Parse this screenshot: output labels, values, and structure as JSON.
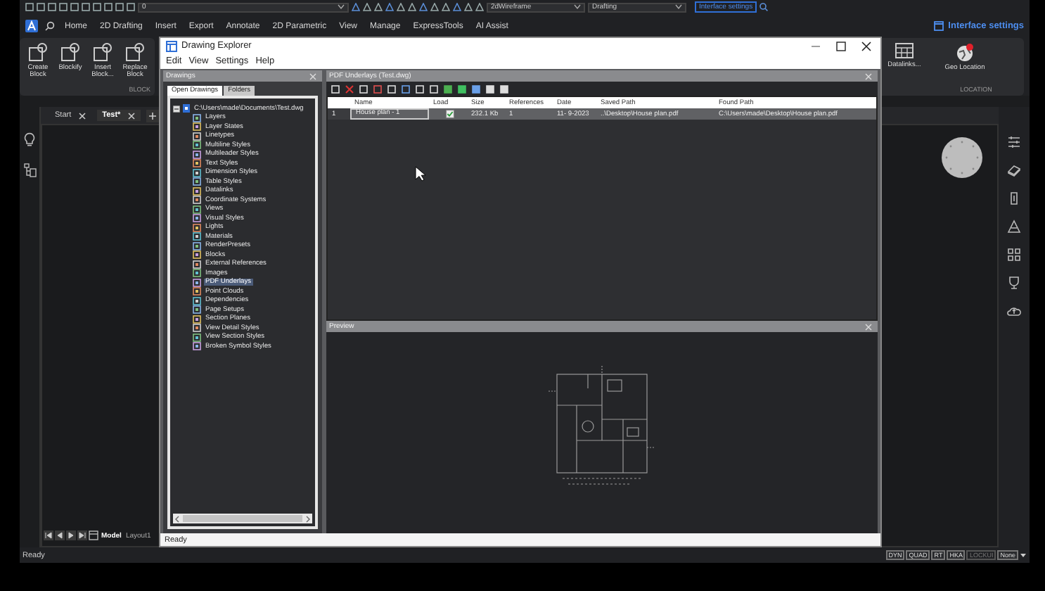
{
  "quick_access": {
    "layer": "0",
    "visual_style": "2dWireframe",
    "workspace": "Drafting",
    "link": "Interface settings"
  },
  "ribbon_tabs": [
    {
      "label": "Home",
      "selected": false
    },
    {
      "label": "2D Drafting",
      "selected": false
    },
    {
      "label": "Insert",
      "selected": false
    },
    {
      "label": "Export",
      "selected": false
    },
    {
      "label": "Annotate",
      "selected": false
    },
    {
      "label": "2D Parametric",
      "selected": false
    },
    {
      "label": "View",
      "selected": false
    },
    {
      "label": "Manage",
      "selected": false
    },
    {
      "label": "ExpressTools",
      "selected": false
    },
    {
      "label": "AI Assist",
      "selected": false
    }
  ],
  "interface_settings": "Interface settings",
  "ribbon": {
    "block_tools": [
      "Create Block",
      "Blockify",
      "Insert Block...",
      "Replace Block"
    ],
    "block_panel": "BLOCK",
    "datalinks": "Datalinks...",
    "geo_location": "Geo Location",
    "location_panel": "LOCATION"
  },
  "doc_tabs": [
    {
      "label": "Start",
      "selected": false
    },
    {
      "label": "Test*",
      "selected": true
    }
  ],
  "layout_tabs": [
    {
      "label": "Model",
      "selected": true
    },
    {
      "label": "Layout1",
      "selected": false
    }
  ],
  "status": "Ready",
  "status_toggles": [
    {
      "label": "DYN",
      "on": true
    },
    {
      "label": "QUAD",
      "on": true
    },
    {
      "label": "RT",
      "on": true
    },
    {
      "label": "HKA",
      "on": true
    },
    {
      "label": "LOCKUI",
      "on": false
    }
  ],
  "annotation_scale": "None",
  "explorer": {
    "title": "Drawing Explorer",
    "menu": [
      "Edit",
      "View",
      "Settings",
      "Help"
    ],
    "drawings_header": "Drawings",
    "side_tabs": [
      {
        "label": "Open Drawings",
        "selected": true
      },
      {
        "label": "Folders",
        "selected": false
      }
    ],
    "tree": {
      "label": "C:\\Users\\made\\Documents\\Test.dwg",
      "expanded": true,
      "children": [
        {
          "label": "Layers",
          "selected": false
        },
        {
          "label": "Layer States",
          "selected": false
        },
        {
          "label": "Linetypes",
          "selected": false
        },
        {
          "label": "Multiline Styles",
          "selected": false
        },
        {
          "label": "Multileader Styles",
          "selected": false
        },
        {
          "label": "Text Styles",
          "selected": false
        },
        {
          "label": "Dimension Styles",
          "selected": false
        },
        {
          "label": "Table Styles",
          "selected": false
        },
        {
          "label": "Datalinks",
          "selected": false
        },
        {
          "label": "Coordinate Systems",
          "selected": false
        },
        {
          "label": "Views",
          "selected": false
        },
        {
          "label": "Visual Styles",
          "selected": false
        },
        {
          "label": "Lights",
          "selected": false
        },
        {
          "label": "Materials",
          "selected": false
        },
        {
          "label": "RenderPresets",
          "selected": false
        },
        {
          "label": "Blocks",
          "selected": false
        },
        {
          "label": "External References",
          "selected": false
        },
        {
          "label": "Images",
          "selected": false
        },
        {
          "label": "PDF Underlays",
          "selected": true
        },
        {
          "label": "Point Clouds",
          "selected": false
        },
        {
          "label": "Dependencies",
          "selected": false
        },
        {
          "label": "Page Setups",
          "selected": false
        },
        {
          "label": "Section Planes",
          "selected": false
        },
        {
          "label": "View Detail Styles",
          "selected": false
        },
        {
          "label": "View Section Styles",
          "selected": false
        },
        {
          "label": "Broken Symbol Styles",
          "selected": false
        }
      ]
    },
    "pane_title": "PDF Underlays (Test.dwg)",
    "columns": [
      "Name",
      "Load",
      "Size",
      "References",
      "Date",
      "Saved Path",
      "Found Path"
    ],
    "rows": [
      {
        "number": "1",
        "name": "House plan - 1",
        "load": true,
        "size": "232.1 Kb",
        "references": "1",
        "date": "11- 9-2023",
        "saved_path": "..\\Desktop\\House plan.pdf",
        "found_path": "C:\\Users\\made\\Desktop\\House plan.pdf",
        "selected": true
      }
    ],
    "preview_header": "Preview",
    "status": "Ready"
  }
}
